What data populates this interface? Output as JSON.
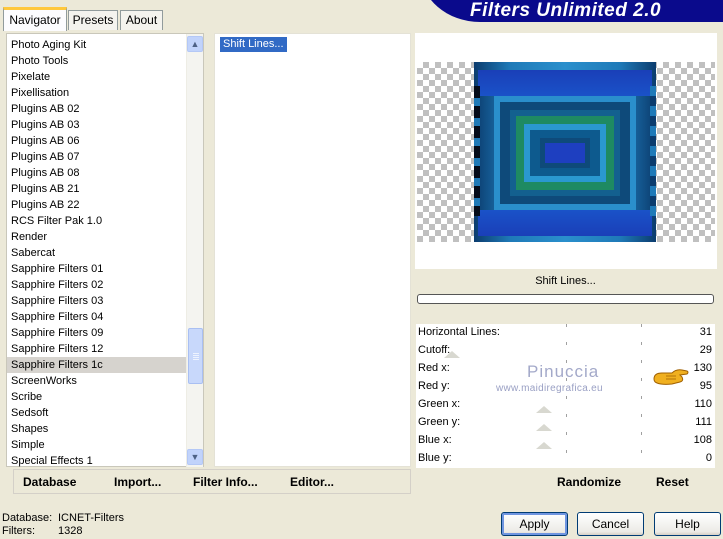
{
  "tabs": [
    {
      "label": "Navigator",
      "active": true
    },
    {
      "label": "Presets",
      "active": false
    },
    {
      "label": "About",
      "active": false
    }
  ],
  "banner_title": "Filters Unlimited 2.0",
  "category_list": [
    {
      "label": "Photo Aging Kit"
    },
    {
      "label": "Photo Tools"
    },
    {
      "label": "Pixelate"
    },
    {
      "label": "Pixellisation"
    },
    {
      "label": "Plugins AB 02"
    },
    {
      "label": "Plugins AB 03"
    },
    {
      "label": "Plugins AB 06"
    },
    {
      "label": "Plugins AB 07"
    },
    {
      "label": "Plugins AB 08"
    },
    {
      "label": "Plugins AB 21"
    },
    {
      "label": "Plugins AB 22"
    },
    {
      "label": "RCS Filter Pak 1.0"
    },
    {
      "label": "Render"
    },
    {
      "label": "Sabercat"
    },
    {
      "label": "Sapphire Filters 01"
    },
    {
      "label": "Sapphire Filters 02"
    },
    {
      "label": "Sapphire Filters 03"
    },
    {
      "label": "Sapphire Filters 04"
    },
    {
      "label": "Sapphire Filters 09"
    },
    {
      "label": "Sapphire Filters 12"
    },
    {
      "label": "Sapphire Filters 1c",
      "selected": true
    },
    {
      "label": "ScreenWorks"
    },
    {
      "label": "Scribe"
    },
    {
      "label": "Sedsoft"
    },
    {
      "label": "Shapes"
    },
    {
      "label": "Simple"
    },
    {
      "label": "Special Effects 1"
    }
  ],
  "filter_list": [
    {
      "label": "Shift Lines...",
      "selected": true
    }
  ],
  "bottom_links": {
    "database": "Database",
    "import": "Import...",
    "filter_info": "Filter Info...",
    "editor": "Editor..."
  },
  "filter_name": "Shift Lines...",
  "parameters": [
    {
      "label": "Horizontal Lines:",
      "value": "31"
    },
    {
      "label": "Cutoff:",
      "value": "29"
    },
    {
      "label": "Red x:",
      "value": "130"
    },
    {
      "label": "Red y:",
      "value": "95"
    },
    {
      "label": "Green x:",
      "value": "110"
    },
    {
      "label": "Green y:",
      "value": "111"
    },
    {
      "label": "Blue x:",
      "value": "108"
    },
    {
      "label": "Blue y:",
      "value": "0"
    }
  ],
  "actions": {
    "randomize": "Randomize",
    "reset": "Reset"
  },
  "watermark": {
    "name": "Pinuccia",
    "url": "www.maidiregrafica.eu"
  },
  "status": {
    "database_label": "Database:",
    "database_value": "ICNET-Filters",
    "filters_label": "Filters:",
    "filters_value": "1328"
  },
  "buttons": {
    "apply": "Apply",
    "cancel": "Cancel",
    "help": "Help"
  },
  "colors": {
    "banner": "#0a0a8c",
    "selection": "#316ac5",
    "dialog_bg": "#ece9d8"
  }
}
